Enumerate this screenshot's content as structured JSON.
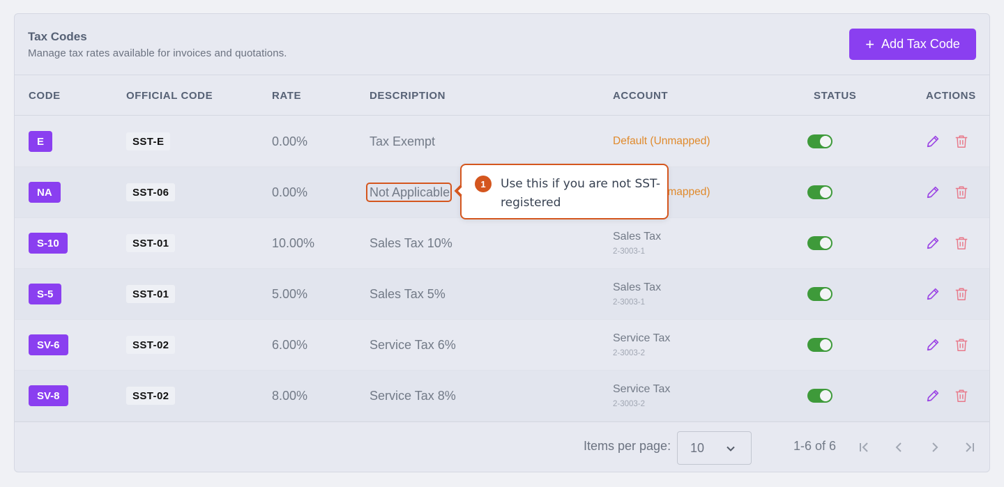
{
  "header": {
    "title": "Tax Codes",
    "subtitle": "Manage tax rates available for invoices and quotations.",
    "add_button": "Add Tax Code",
    "add_icon": "plus-icon"
  },
  "columns": [
    "CODE",
    "OFFICIAL CODE",
    "RATE",
    "DESCRIPTION",
    "ACCOUNT",
    "STATUS",
    "ACTIONS"
  ],
  "rows": [
    {
      "code": "E",
      "official_code": "SST-E",
      "rate": "0.00%",
      "description": "Tax Exempt",
      "account": "Default (Unmapped)",
      "account_code": "",
      "status": "on"
    },
    {
      "code": "NA",
      "official_code": "SST-06",
      "rate": "0.00%",
      "description": "Not Applicable",
      "account": "Default (Unmapped)",
      "account_code": "",
      "status": "on"
    },
    {
      "code": "S-10",
      "official_code": "SST-01",
      "rate": "10.00%",
      "description": "Sales Tax 10%",
      "account": "Sales Tax",
      "account_code": "2-3003-1",
      "status": "on"
    },
    {
      "code": "S-5",
      "official_code": "SST-01",
      "rate": "5.00%",
      "description": "Sales Tax 5%",
      "account": "Sales Tax",
      "account_code": "2-3003-1",
      "status": "on"
    },
    {
      "code": "SV-6",
      "official_code": "SST-02",
      "rate": "6.00%",
      "description": "Service Tax 6%",
      "account": "Service Tax",
      "account_code": "2-3003-2",
      "status": "on"
    },
    {
      "code": "SV-8",
      "official_code": "SST-02",
      "rate": "8.00%",
      "description": "Service Tax 8%",
      "account": "Service Tax",
      "account_code": "2-3003-2",
      "status": "on"
    }
  ],
  "pagination": {
    "items_per_page_label": "Items per page:",
    "items_per_page_value": "10",
    "range": "1-6 of 6"
  },
  "tooltip": {
    "step": "1",
    "text": "Use this if you are not SST-registered"
  },
  "colors": {
    "accent": "#8a3ff0",
    "toggle_on": "#3e9a3a",
    "unmapped": "#e08a2c",
    "delete": "#e8798a",
    "annotation": "#d4561e"
  }
}
